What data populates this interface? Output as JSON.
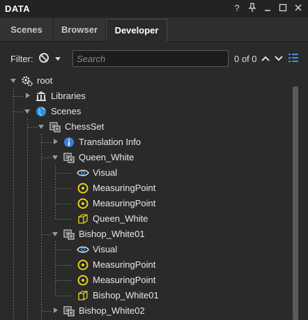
{
  "window": {
    "title": "DATA",
    "help": "?",
    "pin": "Ф",
    "minimize": "–",
    "maximize": "□",
    "close": "✕"
  },
  "tabs": [
    {
      "label": "Scenes"
    },
    {
      "label": "Browser"
    },
    {
      "label": "Developer"
    }
  ],
  "filter": {
    "label": "Filter:",
    "search_placeholder": "Search",
    "count": "0 of 0"
  },
  "tree": [
    {
      "label": "root",
      "icon": "gear-icon"
    },
    {
      "label": "Libraries",
      "icon": "library-icon"
    },
    {
      "label": "Scenes",
      "icon": "globe-icon"
    },
    {
      "label": "ChessSet",
      "icon": "scene-node-icon"
    },
    {
      "label": "Translation Info",
      "icon": "info-icon"
    },
    {
      "label": "Queen_White",
      "icon": "scene-node-icon"
    },
    {
      "label": "Visual",
      "icon": "eye-icon"
    },
    {
      "label": "MeasuringPoint",
      "icon": "measuring-point-icon"
    },
    {
      "label": "MeasuringPoint",
      "icon": "measuring-point-icon"
    },
    {
      "label": "Queen_White",
      "icon": "mesh-cube-icon"
    },
    {
      "label": "Bishop_White01",
      "icon": "scene-node-icon"
    },
    {
      "label": "Visual",
      "icon": "eye-icon"
    },
    {
      "label": "MeasuringPoint",
      "icon": "measuring-point-icon"
    },
    {
      "label": "MeasuringPoint",
      "icon": "measuring-point-icon"
    },
    {
      "label": "Bishop_White01",
      "icon": "mesh-cube-icon"
    },
    {
      "label": "Bishop_White02",
      "icon": "scene-node-icon"
    }
  ],
  "colors": {
    "accent_yellow": "#e8d21a",
    "info_blue": "#3d7fd6",
    "globe_blue": "#2f8fd8"
  }
}
